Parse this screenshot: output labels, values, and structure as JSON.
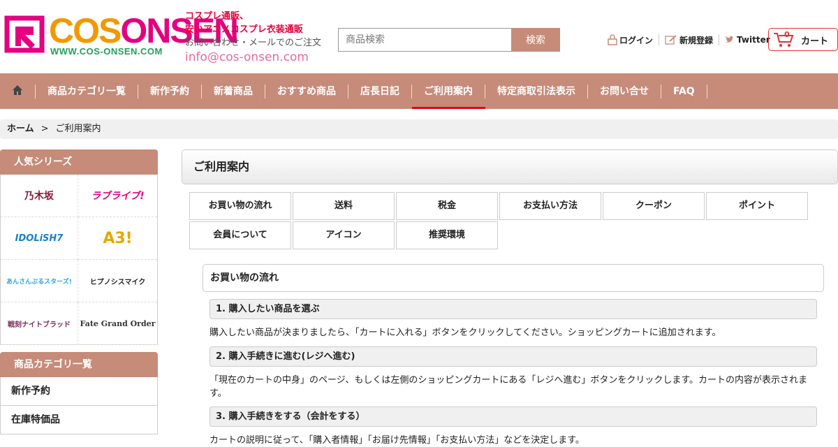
{
  "header": {
    "logo_part1": "COS",
    "logo_part2": "ONSEN",
    "logo_url": "WWW.COS-ONSEN.COM",
    "tagline_1": "コスプレ通販、",
    "tagline_2": "安いアニメコスプレ衣装通販",
    "contact_note": "お問い合わせ・メールでのご注文",
    "email": "info@cos-onsen.com",
    "search_placeholder": "商品検索",
    "search_button": "検索",
    "login": "ログイン",
    "register": "新規登録",
    "twitter": "Twitter",
    "cart_count": "0",
    "cart_label": "カート"
  },
  "nav": {
    "items": [
      {
        "label": "商品カテゴリ一覧"
      },
      {
        "label": "新作予約"
      },
      {
        "label": "新着商品"
      },
      {
        "label": "おすすめ商品"
      },
      {
        "label": "店長日記"
      },
      {
        "label": "ご利用案内",
        "active": true
      },
      {
        "label": "特定商取引法表示"
      },
      {
        "label": "お問い合せ"
      },
      {
        "label": "FAQ"
      }
    ]
  },
  "breadcrumb": {
    "home": "ホーム",
    "separator": ">",
    "current": "ご利用案内"
  },
  "sidebar": {
    "series_title": "人気シリーズ",
    "series": [
      {
        "name": "乃木坂",
        "color": "#8b1a3a"
      },
      {
        "name": "ラブライブ!",
        "color": "#e4007f"
      },
      {
        "name": "IDOLiSH7",
        "color": "#1a7fc9"
      },
      {
        "name": "A3!",
        "color": "#e4a800"
      },
      {
        "name": "あんさんぶるスターズ!",
        "color": "#2aa6e0"
      },
      {
        "name": "ヒプノシスマイク",
        "color": "#222222"
      },
      {
        "name": "戦刻ナイトブラッド",
        "color": "#7a2a5a"
      },
      {
        "name": "Fate Grand Order",
        "color": "#333333"
      }
    ],
    "category_title": "商品カテゴリ一覧",
    "categories": [
      "新作予約",
      "在庫特価品"
    ]
  },
  "main": {
    "title": "ご利用案内",
    "tabs": [
      "お買い物の流れ",
      "送料",
      "税金",
      "お支払い方法",
      "クーポン",
      "ポイント",
      "会員について",
      "アイコン",
      "推奨環境"
    ],
    "section_title": "お買い物の流れ",
    "steps": [
      {
        "title": "1. 購入したい商品を選ぶ",
        "desc": "購入したい商品が決まりましたら、「カートに入れる」ボタンをクリックしてください。ショッピングカートに追加されます。"
      },
      {
        "title": "2. 購入手続きに進む(レジへ進む)",
        "desc": "「現在のカートの中身」のページ、もしくは左側のショッピングカートにある「レジへ進む」ボタンをクリックします。カートの内容が表示されます。"
      },
      {
        "title": "3. 購入手続きをする（会計をする）",
        "desc": "カートの説明に従って、「購入者情報」「お届け先情報」「お支払い方法」などを決定します。"
      }
    ]
  },
  "colors": {
    "accent": "#c68b79",
    "active_underline": "#e60012",
    "logo_pink": "#e4007f",
    "logo_orange": "#f39800",
    "logo_green": "#22a05a"
  }
}
